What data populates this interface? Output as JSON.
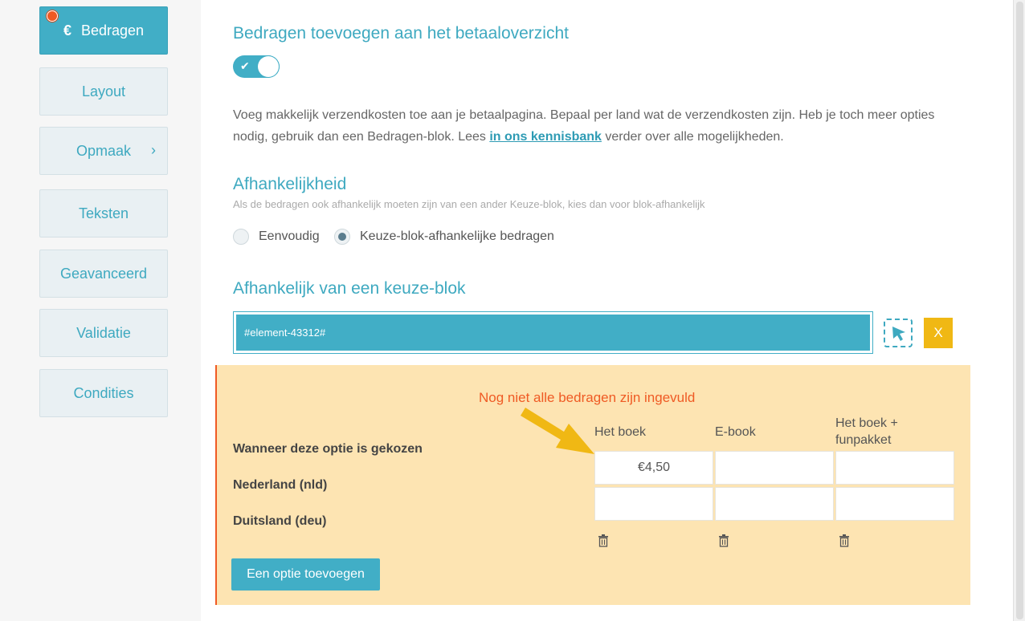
{
  "sidebar": {
    "items": [
      {
        "label": "Bedragen",
        "icon": "euro-icon"
      },
      {
        "label": "Layout"
      },
      {
        "label": "Opmaak",
        "icon": "chevron-right-icon"
      },
      {
        "label": "Teksten"
      },
      {
        "label": "Geavanceerd"
      },
      {
        "label": "Validatie"
      },
      {
        "label": "Condities"
      }
    ],
    "euro_symbol": "€",
    "chevron_symbol": "›"
  },
  "main": {
    "title": "Bedragen toevoegen aan het betaaloverzicht",
    "toggle": {
      "on": true,
      "check": "✔"
    },
    "description_before": "Voeg makkelijk verzendkosten toe aan je betaalpagina. Bepaal per land wat de verzendkosten zijn. Heb je toch meer opties nodig, gebruik dan een Bedragen-blok. Lees ",
    "description_link": "in ons kennisbank",
    "description_after": " verder over alle mogelijkheden.",
    "dependency": {
      "title": "Afhankelijkheid",
      "subtitle": "Als de bedragen ook afhankelijk moeten zijn van een ander Keuze-blok, kies dan voor blok-afhankelijk",
      "options": [
        "Eenvoudig",
        "Keuze-blok-afhankelijke bedragen"
      ],
      "selected": "Keuze-blok-afhankelijke bedragen"
    },
    "choice_block": {
      "title": "Afhankelijk van een keuze-blok",
      "value": "#element-43312#",
      "remove_label": "X"
    },
    "amounts": {
      "warning": "Nog niet alle bedragen zijn ingevuld",
      "header_label": "Wanneer deze optie is gekozen",
      "columns": [
        "Het boek",
        "E-book",
        "Het boek + funpakket"
      ],
      "rows": [
        {
          "label": "Nederland (nld)",
          "values": [
            "€4,50",
            "",
            ""
          ]
        },
        {
          "label": "Duitsland (deu)",
          "values": [
            "",
            "",
            ""
          ]
        }
      ],
      "add_button": "Een optie toevoegen",
      "colors": {
        "background": "#fde4b2",
        "warning": "#ef5a24",
        "arrow": "#f0b814"
      }
    }
  },
  "colors": {
    "accent": "#41aec6",
    "accent_text": "#3ea9c0",
    "yellow_button": "#f0b814"
  }
}
